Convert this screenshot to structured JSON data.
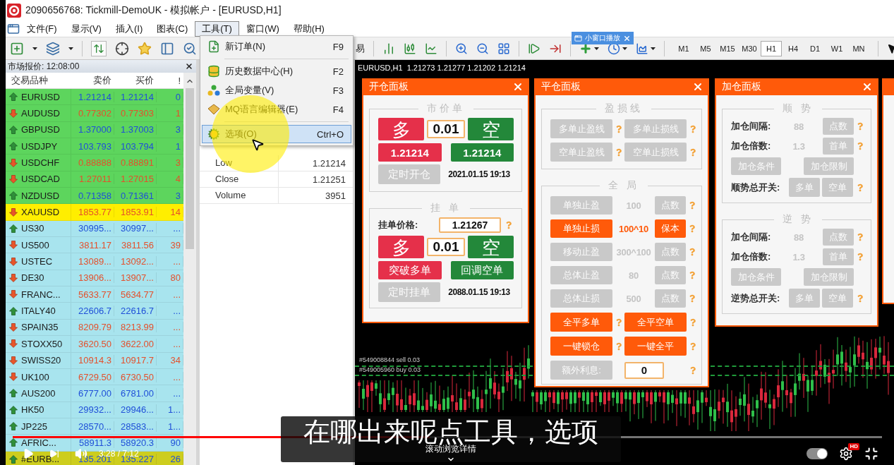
{
  "window": {
    "title": "2090656768: Tickmill-DemoUK - 模拟帐户 - [EURUSD,H1]"
  },
  "menu_bar": [
    {
      "label": "文件(F)",
      "selected": false
    },
    {
      "label": "显示(V)",
      "selected": false
    },
    {
      "label": "插入(I)",
      "selected": false
    },
    {
      "label": "图表(C)",
      "selected": false
    },
    {
      "label": "工具(T)",
      "selected": true
    },
    {
      "label": "窗口(W)",
      "selected": false
    },
    {
      "label": "帮助(H)",
      "selected": false
    }
  ],
  "toolbar": {
    "partial_button_label": "易",
    "timeframes": [
      {
        "label": "M1",
        "selected": false
      },
      {
        "label": "M5",
        "selected": false
      },
      {
        "label": "M15",
        "selected": false
      },
      {
        "label": "M30",
        "selected": false
      },
      {
        "label": "H1",
        "selected": true
      },
      {
        "label": "H4",
        "selected": false
      },
      {
        "label": "D1",
        "selected": false
      },
      {
        "label": "W1",
        "selected": false
      },
      {
        "label": "MN",
        "selected": false
      }
    ]
  },
  "overlay_button": {
    "label": "小窗口播放"
  },
  "tools_menu": {
    "groups": [
      [
        {
          "label": "新订单(N)",
          "shortcut": "F9",
          "selected": false
        }
      ],
      [
        {
          "label": "历史数据中心(H)",
          "shortcut": "F2",
          "selected": false
        },
        {
          "label": "全局变量(V)",
          "shortcut": "F3",
          "selected": false
        },
        {
          "label": "MQ语言编辑器(E)",
          "shortcut": "F4",
          "selected": false
        }
      ],
      [
        {
          "label": "选项(O)",
          "shortcut": "Ctrl+O",
          "selected": true
        }
      ]
    ]
  },
  "market_watch": {
    "title": "市场报价: 12:08:00",
    "columns": [
      "交易品种",
      "卖价",
      "买价",
      "!"
    ],
    "rows": [
      {
        "symbol": "EURUSD",
        "bid": "1.21214",
        "ask": "1.21214",
        "spread": "0",
        "kind": "up",
        "color": "#5dd55d"
      },
      {
        "symbol": "AUDUSD",
        "bid": "0.77302",
        "ask": "0.77303",
        "spread": "1",
        "kind": "down",
        "color": "#5dd55d"
      },
      {
        "symbol": "GBPUSD",
        "bid": "1.37000",
        "ask": "1.37003",
        "spread": "3",
        "kind": "up",
        "color": "#5dd55d"
      },
      {
        "symbol": "USDJPY",
        "bid": "103.793",
        "ask": "103.794",
        "spread": "1",
        "kind": "up",
        "color": "#5dd55d"
      },
      {
        "symbol": "USDCHF",
        "bid": "0.88888",
        "ask": "0.88891",
        "spread": "3",
        "kind": "down",
        "color": "#5dd55d"
      },
      {
        "symbol": "USDCAD",
        "bid": "1.27011",
        "ask": "1.27015",
        "spread": "4",
        "kind": "down",
        "color": "#5dd55d"
      },
      {
        "symbol": "NZDUSD",
        "bid": "0.71358",
        "ask": "0.71361",
        "spread": "3",
        "kind": "up",
        "color": "#5dd55d"
      },
      {
        "symbol": "XAUUSD",
        "bid": "1853.77",
        "ask": "1853.91",
        "spread": "14",
        "kind": "down",
        "color": "#ffee00"
      },
      {
        "symbol": "US30",
        "bid": "30995...",
        "ask": "30997...",
        "spread": "...",
        "kind": "up",
        "color": "#a8e4ee"
      },
      {
        "symbol": "US500",
        "bid": "3811.17",
        "ask": "3811.56",
        "spread": "39",
        "kind": "down",
        "color": "#a8e4ee"
      },
      {
        "symbol": "USTEC",
        "bid": "13089...",
        "ask": "13092...",
        "spread": "...",
        "kind": "down",
        "color": "#a8e4ee"
      },
      {
        "symbol": "DE30",
        "bid": "13906...",
        "ask": "13907...",
        "spread": "80",
        "kind": "down",
        "color": "#a8e4ee"
      },
      {
        "symbol": "FRANC...",
        "bid": "5633.77",
        "ask": "5634.77",
        "spread": "...",
        "kind": "down",
        "color": "#a8e4ee"
      },
      {
        "symbol": "ITALY40",
        "bid": "22606.7",
        "ask": "22616.7",
        "spread": "...",
        "kind": "up",
        "color": "#a8e4ee"
      },
      {
        "symbol": "SPAIN35",
        "bid": "8209.79",
        "ask": "8213.99",
        "spread": "...",
        "kind": "down",
        "color": "#a8e4ee"
      },
      {
        "symbol": "STOXX50",
        "bid": "3620.50",
        "ask": "3622.00",
        "spread": "...",
        "kind": "down",
        "color": "#a8e4ee"
      },
      {
        "symbol": "SWISS20",
        "bid": "10914.3",
        "ask": "10917.7",
        "spread": "34",
        "kind": "down",
        "color": "#a8e4ee"
      },
      {
        "symbol": "UK100",
        "bid": "6729.50",
        "ask": "6730.50",
        "spread": "...",
        "kind": "down",
        "color": "#a8e4ee"
      },
      {
        "symbol": "AUS200",
        "bid": "6777.00",
        "ask": "6781.00",
        "spread": "...",
        "kind": "up",
        "color": "#a8e4ee"
      },
      {
        "symbol": "HK50",
        "bid": "29932...",
        "ask": "29946...",
        "spread": "1...",
        "kind": "up",
        "color": "#a8e4ee"
      },
      {
        "symbol": "JP225",
        "bid": "28570...",
        "ask": "28583...",
        "spread": "1...",
        "kind": "up",
        "color": "#a8e4ee"
      },
      {
        "symbol": "AFRIC...",
        "bid": "58911.3",
        "ask": "58920.3",
        "spread": "90",
        "kind": "up",
        "color": "#a8e4ee"
      },
      {
        "symbol": "#EURB...",
        "bid": "135.201",
        "ask": "135.227",
        "spread": "26",
        "kind": "up",
        "color": "#cdcd1e"
      }
    ]
  },
  "data_window": {
    "rows": [
      {
        "label": "Low",
        "value": "1.21214"
      },
      {
        "label": "Close",
        "value": "1.21251"
      },
      {
        "label": "Volume",
        "value": "3951"
      }
    ]
  },
  "chart": {
    "header": "EURUSD,H1  1.21273 1.21277 1.21202 1.21214",
    "trade_labels": [
      "#549008844 sell 0.03",
      "#549005960 buy 0.03"
    ],
    "open_panel": {
      "title": "开仓面板",
      "market_order": {
        "legend": "市价单",
        "buy": {
          "label": "多",
          "kind": "buy"
        },
        "lots": "0.01",
        "sell": {
          "label": "空",
          "kind": "sell"
        },
        "bid": {
          "label": "1.21214",
          "kind": "buy"
        },
        "ask": {
          "label": "1.21214",
          "kind": "sell"
        },
        "timer": {
          "label": "定时开仓",
          "kind": "off"
        },
        "time": "2021.01.15 19:13"
      },
      "pending_order": {
        "legend": "挂 单",
        "price_label": "挂单价格:",
        "price": "1.21267",
        "buy": {
          "label": "多",
          "kind": "buy"
        },
        "lots": "0.01",
        "sell": {
          "label": "空",
          "kind": "sell"
        },
        "buy_stop": {
          "label": "突破多单",
          "kind": "buy"
        },
        "sell_limit": {
          "label": "回调空单",
          "kind": "sell"
        },
        "timer": {
          "label": "定时挂单",
          "kind": "off"
        },
        "time": "2088.01.15 19:13"
      }
    },
    "close_panel": {
      "title": "平仓面板",
      "lines": {
        "legend": "盈损线",
        "buttons": [
          {
            "label": "多单止盈线",
            "kind": "off"
          },
          {
            "label": "多单止损线",
            "kind": "off"
          },
          {
            "label": "空单止盈线",
            "kind": "off"
          },
          {
            "label": "空单止损线",
            "kind": "off"
          }
        ]
      },
      "global": {
        "legend": "全 局",
        "rows": [
          {
            "label": "单独止盈",
            "value": "100",
            "unit": "点数",
            "kind": "off"
          },
          {
            "label": "单独止损",
            "value": "100^10",
            "unit": "保本",
            "kind": "on"
          },
          {
            "label": "移动止盈",
            "value": "300^100",
            "unit": "点数",
            "kind": "off"
          },
          {
            "label": "总体止盈",
            "value": "80",
            "unit": "点数",
            "kind": "off"
          },
          {
            "label": "总体止损",
            "value": "500",
            "unit": "点数",
            "kind": "off"
          }
        ],
        "actions": [
          {
            "label": "全平多单",
            "kind": "on"
          },
          {
            "label": "全平空单",
            "kind": "on"
          },
          {
            "label": "一键锁仓",
            "kind": "on"
          },
          {
            "label": "一键全平",
            "kind": "on"
          }
        ],
        "extra": {
          "label": "额外利息:",
          "kind": "off",
          "value": "0"
        }
      }
    },
    "add_panel": {
      "title": "加仓面板",
      "sections": [
        {
          "legend": "顺 势",
          "rows": [
            {
              "kind": "field",
              "label": "加仓间隔:",
              "value": "88",
              "unit": {
                "label": "点数",
                "kind": "off"
              }
            },
            {
              "kind": "field",
              "label": "加仓倍数:",
              "value": "1.3",
              "unit": {
                "label": "首单",
                "kind": "off"
              }
            },
            {
              "kind": "buttons",
              "buttons": [
                {
                  "label": "加仓条件",
                  "kind": "off"
                },
                {
                  "label": "加仓限制",
                  "kind": "off"
                }
              ]
            },
            {
              "kind": "switch",
              "label": "顺势总开关:",
              "buttons": [
                {
                  "label": "多单",
                  "kind": "off"
                },
                {
                  "label": "空单",
                  "kind": "off"
                }
              ]
            }
          ]
        },
        {
          "legend": "逆 势",
          "rows": [
            {
              "kind": "field",
              "label": "加仓间隔:",
              "value": "88",
              "unit": {
                "label": "点数",
                "kind": "off"
              }
            },
            {
              "kind": "field",
              "label": "加仓倍数:",
              "value": "1.3",
              "unit": {
                "label": "首单",
                "kind": "off"
              }
            },
            {
              "kind": "buttons",
              "buttons": [
                {
                  "label": "加仓条件",
                  "kind": "off"
                },
                {
                  "label": "加仓限制",
                  "kind": "off"
                }
              ]
            },
            {
              "kind": "switch",
              "label": "逆势总开关:",
              "buttons": [
                {
                  "label": "多单",
                  "kind": "off"
                },
                {
                  "label": "空单",
                  "kind": "off"
                }
              ]
            }
          ]
        }
      ]
    }
  },
  "video_player": {
    "subtitle": "在哪出来呢点工具，选项",
    "time": "3:28 / 7:12",
    "progress": {
      "level": 0.48
    },
    "scroll_hint": "滚动浏览详情",
    "autoplay": {
      "on": true
    },
    "quality_badge": "HD"
  }
}
